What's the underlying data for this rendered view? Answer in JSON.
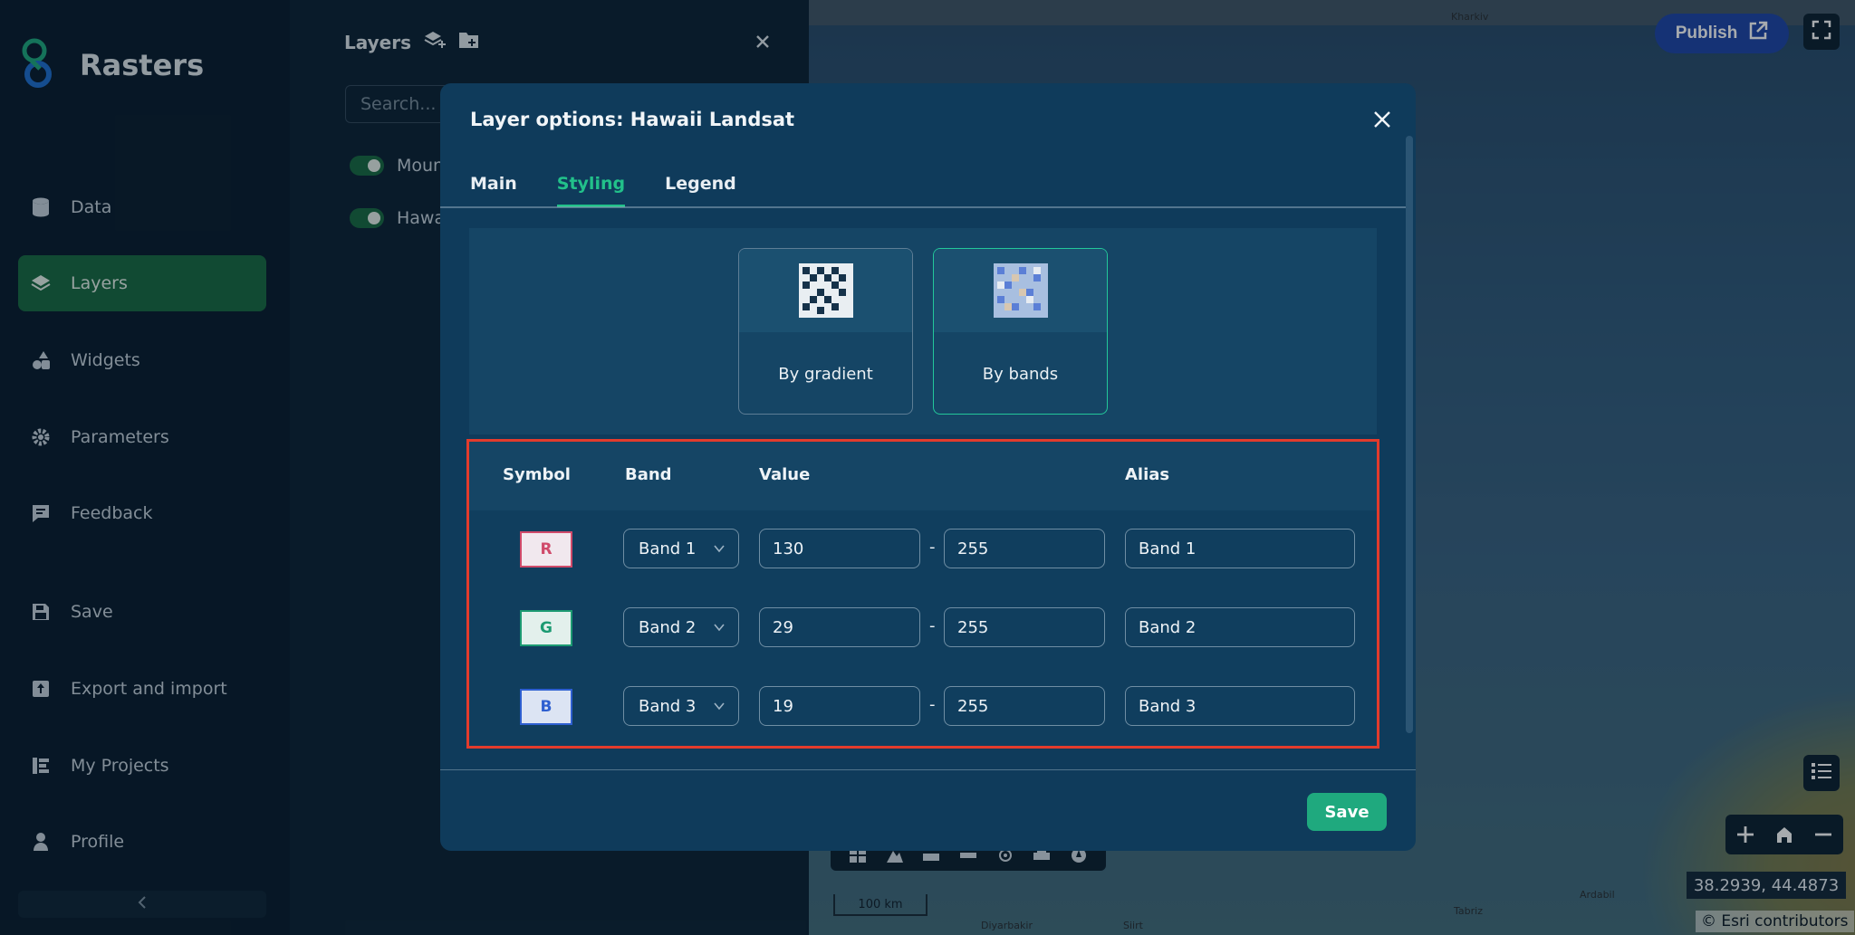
{
  "app": {
    "title": "Rasters"
  },
  "sidebar": {
    "items": [
      {
        "label": "Data",
        "icon": "database-icon"
      },
      {
        "label": "Layers",
        "icon": "layers-icon",
        "active": true
      },
      {
        "label": "Widgets",
        "icon": "widgets-icon"
      },
      {
        "label": "Parameters",
        "icon": "gear-icon"
      },
      {
        "label": "Feedback",
        "icon": "feedback-icon"
      },
      {
        "label": "Save",
        "icon": "floppy-icon"
      },
      {
        "label": "Export and import",
        "icon": "export-icon"
      },
      {
        "label": "My Projects",
        "icon": "projects-icon"
      },
      {
        "label": "Profile",
        "icon": "user-icon"
      }
    ]
  },
  "layers_panel": {
    "title": "Layers",
    "search_placeholder": "Search...",
    "layers": [
      {
        "label": "Moun",
        "enabled": true
      },
      {
        "label": "Hawa",
        "enabled": true
      }
    ]
  },
  "modal": {
    "title": "Layer options: Hawaii Landsat",
    "tabs": [
      {
        "label": "Main"
      },
      {
        "label": "Styling",
        "active": true
      },
      {
        "label": "Legend"
      }
    ],
    "style_options": [
      {
        "label": "By gradient",
        "selected": false
      },
      {
        "label": "By bands",
        "selected": true
      }
    ],
    "bands_table": {
      "headers": {
        "symbol": "Symbol",
        "band": "Band",
        "value": "Value",
        "alias": "Alias"
      },
      "rows": [
        {
          "symbol": "R",
          "band": "Band 1",
          "min": "130",
          "max": "255",
          "alias": "Band 1",
          "color": "#d04a6a"
        },
        {
          "symbol": "G",
          "band": "Band 2",
          "min": "29",
          "max": "255",
          "alias": "Band 2",
          "color": "#1c9a72"
        },
        {
          "symbol": "B",
          "band": "Band 3",
          "min": "19",
          "max": "255",
          "alias": "Band 3",
          "color": "#2e5fd0"
        }
      ],
      "separator": "-"
    },
    "save_label": "Save"
  },
  "map": {
    "publish_label": "Publish",
    "coordinates": "38.2939, 44.4873",
    "attribution": "© Esri contributors",
    "scale_label": "100 km",
    "places": [
      "Diyarbakir",
      "Siirt",
      "Tabriz",
      "Ardabil",
      "Kharkiv"
    ]
  },
  "colors": {
    "accent": "#22c18a",
    "active_nav": "#1a6b42",
    "highlight": "#e33b2c",
    "publish": "#1f45a8"
  }
}
